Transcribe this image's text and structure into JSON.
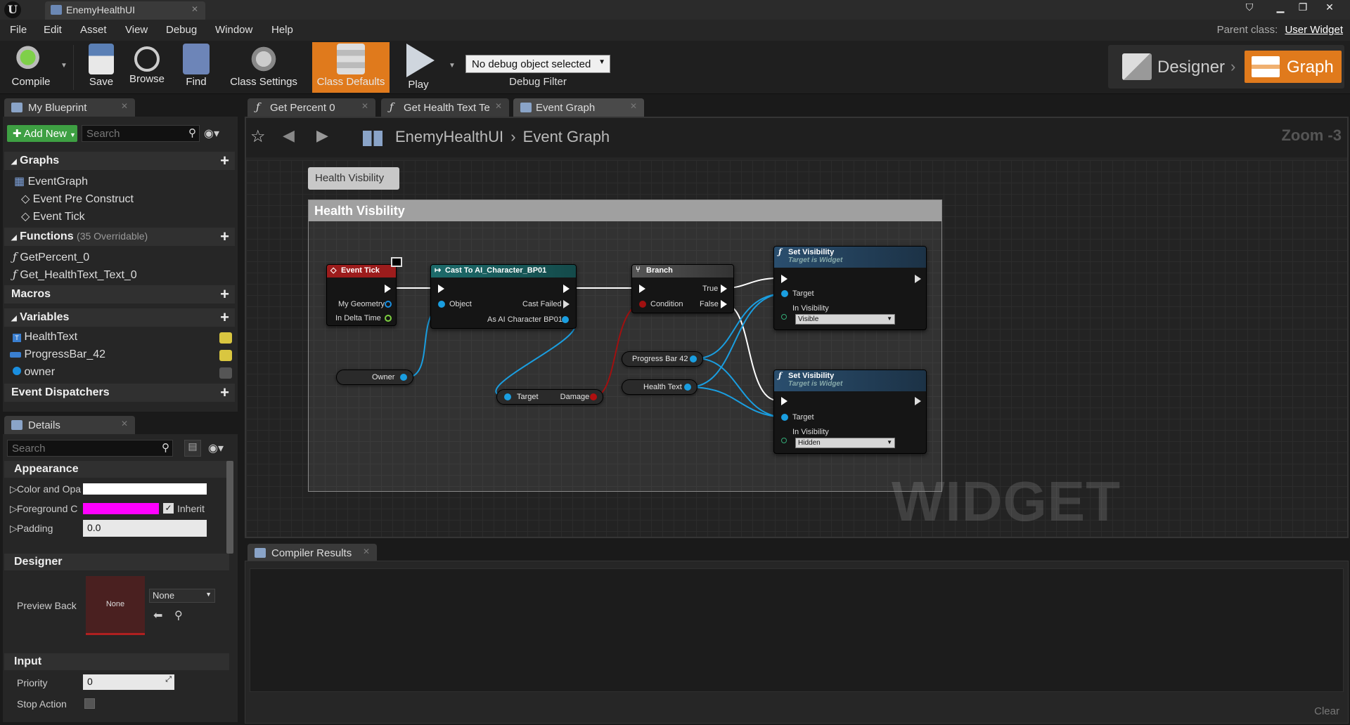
{
  "window": {
    "tab_title": "EnemyHealthUI",
    "logo": "U",
    "buttons": [
      "minimize-icon",
      "restore-icon",
      "close-icon"
    ]
  },
  "menu": {
    "items": [
      "File",
      "Edit",
      "Asset",
      "View",
      "Debug",
      "Window",
      "Help"
    ],
    "parent_class_label": "Parent class:",
    "parent_class_value": "User Widget"
  },
  "toolbar": {
    "compile": "Compile",
    "save": "Save",
    "browse": "Browse",
    "find": "Find",
    "class_settings": "Class Settings",
    "class_defaults": "Class Defaults",
    "play": "Play",
    "debug_select": "No debug object selected",
    "debug_filter": "Debug Filter",
    "designer": "Designer",
    "graph": "Graph",
    "accent": "#e07a1c"
  },
  "my_blueprint": {
    "tab": "My Blueprint",
    "add_new": "Add New",
    "search_placeholder": "Search",
    "sections": {
      "graphs": "Graphs",
      "functions": "Functions",
      "functions_sub": "(35 Overridable)",
      "macros": "Macros",
      "variables": "Variables",
      "dispatchers": "Event Dispatchers"
    },
    "graphs": [
      "EventGraph",
      "Event Pre Construct",
      "Event Tick"
    ],
    "functions": [
      "GetPercent_0",
      "Get_HealthText_Text_0"
    ],
    "variables": [
      "HealthText",
      "ProgressBar_42",
      "owner"
    ]
  },
  "details": {
    "tab": "Details",
    "search_placeholder": "Search",
    "appearance": "Appearance",
    "color_label": "Color and Opa",
    "foreground_label": "Foreground C",
    "inherit_label": "Inherit",
    "padding_label": "Padding",
    "padding_value": "0.0",
    "designer": "Designer",
    "preview_back_label": "Preview Back",
    "preview_none": "None",
    "preview_select": "None",
    "input": "Input",
    "priority_label": "Priority",
    "priority_value": "0",
    "stop_action_label": "Stop Action"
  },
  "graph_tabs": [
    "Get Percent 0",
    "Get Health Text Te",
    "Event Graph"
  ],
  "graph": {
    "breadcrumb_root": "EnemyHealthUI",
    "breadcrumb_leaf": "Event Graph",
    "zoom": "Zoom -3",
    "watermark": "WIDGET BLUEPRINT",
    "comment": "Health Visbility",
    "nodes": {
      "event_tick": {
        "title": "Event Tick",
        "pins": [
          "My Geometry",
          "In Delta Time"
        ]
      },
      "cast": {
        "title": "Cast To AI_Character_BP01",
        "object": "Object",
        "failed": "Cast Failed",
        "as": "As AI Character BP01"
      },
      "branch": {
        "title": "Branch",
        "condition": "Condition",
        "true": "True",
        "false": "False"
      },
      "set_vis_1": {
        "title": "Set Visibility",
        "sub": "Target is Widget",
        "target": "Target",
        "in_vis": "In Visibility",
        "value": "Visible"
      },
      "set_vis_2": {
        "title": "Set Visibility",
        "sub": "Target is Widget",
        "target": "Target",
        "in_vis": "In Visibility",
        "value": "Hidden"
      },
      "owner": "Owner",
      "damage": {
        "target": "Target",
        "damage": "Damage"
      },
      "progress_bar": "Progress Bar 42",
      "health_text": "Health Text"
    }
  },
  "compiler": {
    "tab": "Compiler Results",
    "clear": "Clear"
  }
}
